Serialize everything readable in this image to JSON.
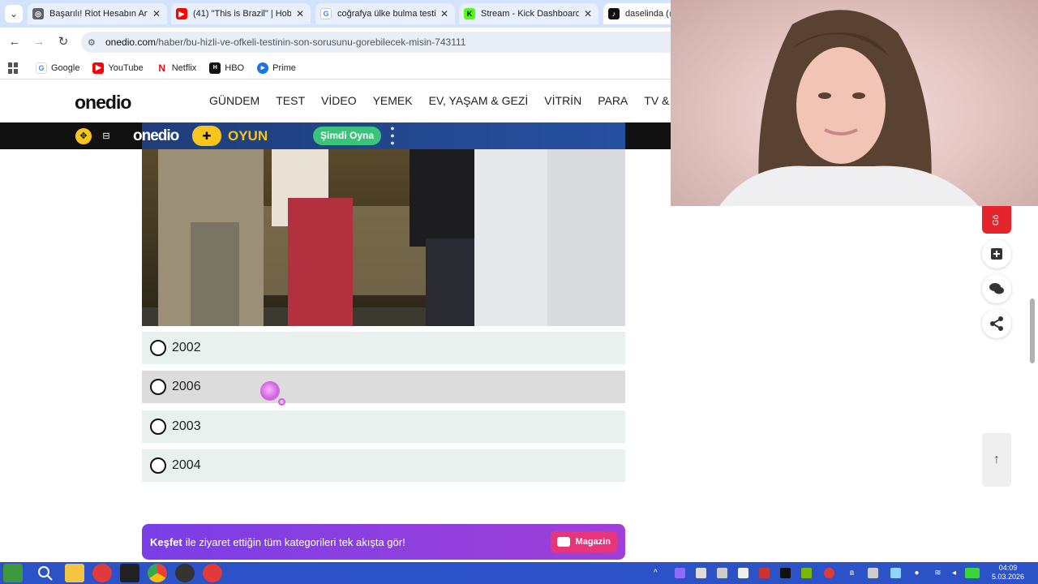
{
  "browser": {
    "tabs": [
      {
        "title": "Başarılı! Riot Hesabın Artık",
        "icon": "globe-icon",
        "active": false
      },
      {
        "title": "(41) \"This is Brazil\" | Hobbs",
        "icon": "youtube-icon",
        "active": false
      },
      {
        "title": "coğrafya ülke bulma testi",
        "icon": "google-icon",
        "active": false
      },
      {
        "title": "Stream - Kick Dashboard",
        "icon": "kick-icon",
        "active": false
      },
      {
        "title": "daselinda (@",
        "icon": "tiktok-icon",
        "active": true
      }
    ],
    "url_host": "onedio.com",
    "url_path": "/haber/bu-hizli-ve-ofkeli-testinin-son-sorusunu-gorebilecek-misin-743111",
    "bookmarks": [
      {
        "label": "Google",
        "icon": "google-icon"
      },
      {
        "label": "YouTube",
        "icon": "youtube-icon"
      },
      {
        "label": "Netflix",
        "icon": "netflix-icon"
      },
      {
        "label": "HBO",
        "icon": "hbo-icon"
      },
      {
        "label": "Prime",
        "icon": "prime-icon"
      }
    ]
  },
  "site": {
    "logo": "onedio",
    "nav": [
      "GÜNDEM",
      "TEST",
      "VİDEO",
      "YEMEK",
      "EV, YAŞAM & GEZİ",
      "VİTRİN",
      "PARA",
      "TV & Sİ"
    ],
    "game_bar": {
      "logo": "onedio",
      "game_label": "OYUN",
      "play_button": "Şimdi Oyna"
    }
  },
  "quiz": {
    "answers": [
      "2002",
      "2006",
      "2003",
      "2004"
    ],
    "hovered_index": 1
  },
  "discover": {
    "bold": "Keşfet",
    "text": " ile ziyaret ettiğin tüm kategorileri tek akışta gör!",
    "button": "Magazin"
  },
  "rail": {
    "red_tab_label": "Gö"
  },
  "taskbar": {
    "time": "04:09",
    "date": "5.03.2026"
  },
  "colors": {
    "accent_green": "#3ac479",
    "game_yellow": "#f7c51e",
    "discover_purple": "#8a3fe0",
    "magazin_pink": "#e8347a",
    "rail_red": "#e5242c",
    "taskbar_blue": "#2b52c6"
  }
}
